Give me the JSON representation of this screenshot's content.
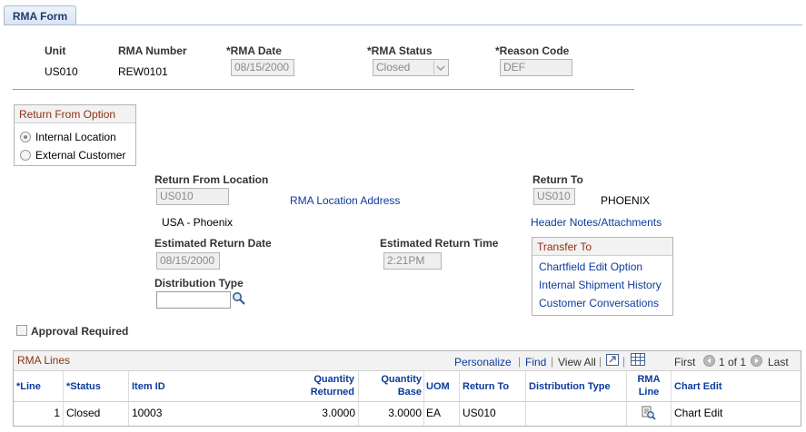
{
  "tab": {
    "label": "RMA Form"
  },
  "header": {
    "unit_label": "Unit",
    "unit_value": "US010",
    "rma_number_label": "RMA Number",
    "rma_number_value": "REW0101",
    "rma_date_label": "*RMA Date",
    "rma_date_value": "08/15/2000",
    "rma_status_label": "*RMA Status",
    "rma_status_value": "Closed",
    "reason_code_label": "*Reason Code",
    "reason_code_value": "DEF"
  },
  "return_from_option": {
    "title": "Return From Option",
    "options": [
      {
        "label": "Internal Location",
        "selected": true
      },
      {
        "label": "External Customer",
        "selected": false
      }
    ]
  },
  "location": {
    "return_from_label": "Return From Location",
    "return_from_value": "US010",
    "rma_location_address_link": "RMA Location Address",
    "return_from_desc": "USA - Phoenix",
    "return_to_label": "Return To",
    "return_to_value": "US010",
    "return_to_desc": "PHOENIX",
    "header_notes_link": "Header Notes/Attachments",
    "est_return_date_label": "Estimated Return Date",
    "est_return_date_value": "08/15/2000",
    "est_return_time_label": "Estimated Return Time",
    "est_return_time_value": "2:21PM",
    "distribution_type_label": "Distribution Type",
    "distribution_type_value": ""
  },
  "transfer_to": {
    "title": "Transfer To",
    "links": [
      "Chartfield Edit Option",
      "Internal Shipment History",
      "Customer Conversations"
    ]
  },
  "approval": {
    "label": "Approval Required",
    "checked": false
  },
  "rma_lines": {
    "title": "RMA Lines",
    "personalize": "Personalize",
    "find": "Find",
    "view_all": "View All",
    "first": "First",
    "range": "1 of 1",
    "last": "Last",
    "columns": {
      "line": "*Line",
      "status": "*Status",
      "item_id": "Item ID",
      "qty_returned": [
        "Quantity",
        "Returned"
      ],
      "qty_base": [
        "Quantity",
        "Base"
      ],
      "uom": "UOM",
      "return_to": "Return To",
      "distribution_type": "Distribution Type",
      "rma_line": [
        "RMA",
        "Line"
      ],
      "chart_edit": "Chart Edit"
    },
    "rows": [
      {
        "line": "1",
        "status": "Closed",
        "item_id": "10003",
        "qty_returned": "3.0000",
        "qty_base": "3.0000",
        "uom": "EA",
        "return_to": "US010",
        "distribution_type": "",
        "chart_edit": "Chart Edit"
      }
    ]
  },
  "icons": {
    "search": "magnifier-icon",
    "zoom_grid": "zoom-grid-icon",
    "download": "spreadsheet-icon",
    "prev": "arrow-left-icon",
    "next": "arrow-right-icon",
    "rma_line_detail": "detail-magnifier-icon"
  }
}
